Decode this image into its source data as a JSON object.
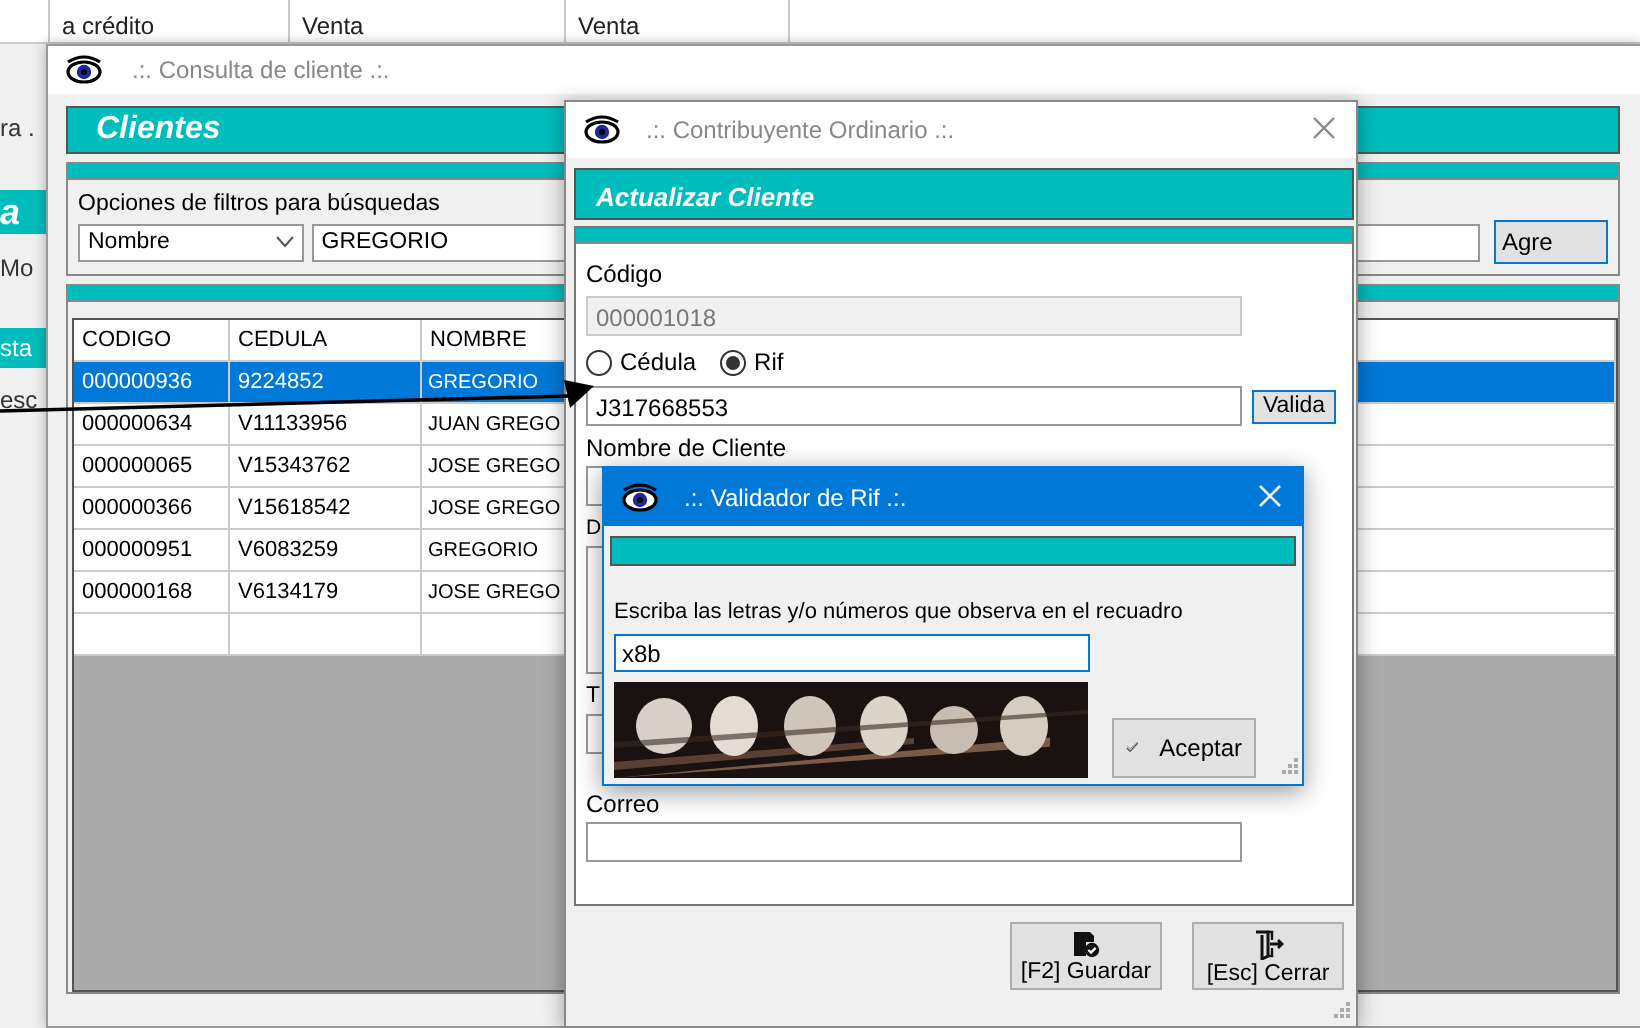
{
  "background_app": {
    "header_columns": [
      "a crédito",
      "Venta",
      "Venta"
    ],
    "side_fragments": [
      {
        "text": "ra .",
        "kind": "plain"
      },
      {
        "text": "a",
        "kind": "banner"
      },
      {
        "text": "Mo",
        "kind": "plain"
      },
      {
        "text": "sta",
        "kind": "tab"
      },
      {
        "text": "esc",
        "kind": "plain"
      }
    ]
  },
  "consulta_window": {
    "title": ".:. Consulta de cliente .:.",
    "header": "Clientes",
    "filter_label": "Opciones de filtros para búsquedas",
    "filter_option": "Nombre",
    "search_value": "GREGORIO",
    "add_button": "Agre",
    "table": {
      "columns": [
        "CODIGO",
        "CEDULA",
        "NOMBRE"
      ],
      "rows": [
        {
          "cells": [
            "000000936",
            "9224852",
            "GREGORIO"
          ],
          "selected": true
        },
        {
          "cells": [
            "000000634",
            "V11133956",
            "JUAN GREGO"
          ],
          "selected": false
        },
        {
          "cells": [
            "000000065",
            "V15343762",
            "JOSE GREGO"
          ],
          "selected": false
        },
        {
          "cells": [
            "000000366",
            "V15618542",
            "JOSE GREGO"
          ],
          "selected": false
        },
        {
          "cells": [
            "000000951",
            "V6083259",
            "GREGORIO"
          ],
          "selected": false
        },
        {
          "cells": [
            "000000168",
            "V6134179",
            "JOSE GREGO"
          ],
          "selected": false
        }
      ]
    }
  },
  "contribuyente_window": {
    "title": ".:. Contribuyente Ordinario .:.",
    "header": "Actualizar Cliente",
    "codigo_label": "Código",
    "codigo_value": "000001018",
    "id_types": [
      {
        "label": "Cédula",
        "selected": false
      },
      {
        "label": "Rif",
        "selected": true
      }
    ],
    "rif_value": "J317668553",
    "validate_button": "Valida",
    "name_label": "Nombre de Cliente",
    "label_4": "D",
    "label_5": "T",
    "email_label": "Correo",
    "buttons": [
      {
        "label": "[F2] Guardar",
        "kind": "save"
      },
      {
        "label": "[Esc] Cerrar",
        "kind": "exit"
      }
    ]
  },
  "validator_window": {
    "title": ".:. Validador de Rif .:.",
    "prompt": "Escriba las letras y/o números que observa en el recuadro",
    "answer_value": "x8b",
    "accept_button": "Aceptar"
  }
}
